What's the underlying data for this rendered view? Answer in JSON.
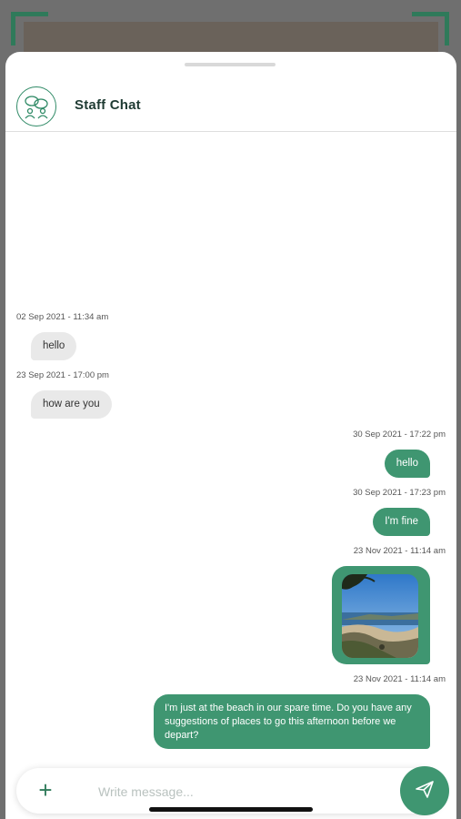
{
  "header": {
    "title": "Staff Chat",
    "avatar_icon": "group-chat-icon"
  },
  "messages": [
    {
      "direction": "in",
      "timestamp": "02 Sep 2021 - 11:34 am",
      "text": "hello"
    },
    {
      "direction": "in",
      "timestamp": "23 Sep 2021 - 17:00 pm",
      "text": "how are you"
    },
    {
      "direction": "out",
      "timestamp": "30 Sep 2021 - 17:22 pm",
      "text": "hello"
    },
    {
      "direction": "out",
      "timestamp": "30 Sep 2021 - 17:23 pm",
      "text": "I'm fine"
    },
    {
      "direction": "out",
      "timestamp": "23 Nov 2021 - 11:14 am",
      "type": "image",
      "image": "beach-photo"
    },
    {
      "direction": "out",
      "timestamp": "23 Nov 2021 - 11:14 am",
      "text": "I'm just at the beach in our spare time. Do you have any suggestions of places to go this afternoon before we depart?"
    }
  ],
  "composer": {
    "placeholder": "Write message...",
    "value": "",
    "add_icon": "plus-icon",
    "send_icon": "send-icon"
  },
  "colors": {
    "accent": "#3f9671",
    "incoming_bubble": "#e9e9e9",
    "brand_dark": "#2f7a5a"
  }
}
